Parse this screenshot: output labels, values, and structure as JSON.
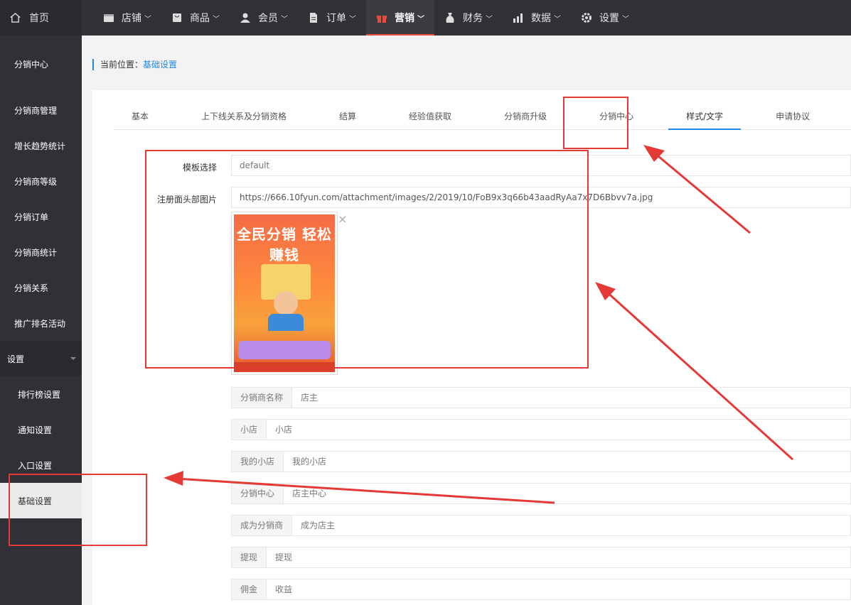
{
  "topbar": {
    "home": "首页",
    "nav": [
      {
        "label": "店铺",
        "icon": "store-icon"
      },
      {
        "label": "商品",
        "icon": "goods-icon"
      },
      {
        "label": "会员",
        "icon": "member-icon"
      },
      {
        "label": "订单",
        "icon": "order-icon"
      },
      {
        "label": "营销",
        "icon": "gift-icon",
        "active": true
      },
      {
        "label": "财务",
        "icon": "money-bag-icon"
      },
      {
        "label": "数据",
        "icon": "bar-chart-icon"
      },
      {
        "label": "设置",
        "icon": "gear-icon"
      }
    ]
  },
  "sidebar": {
    "items": [
      "分销中心",
      "分销商管理",
      "增长趋势统计",
      "分销商等级",
      "分销订单",
      "分销商统计",
      "分销关系",
      "推广排名活动"
    ],
    "group": "设置",
    "sub_items": [
      "排行榜设置",
      "通知设置",
      "入口设置",
      "基础设置"
    ]
  },
  "breadcrumb": {
    "prefix": "当前位置：",
    "link": "基础设置"
  },
  "tabs": [
    "基本",
    "上下线关系及分销资格",
    "结算",
    "经验值获取",
    "分销商升级",
    "分销中心",
    "样式/文字",
    "申请协议"
  ],
  "active_tab": "样式/文字",
  "form": {
    "template_label": "模板选择",
    "template_value": "default",
    "header_image_label": "注册面头部图片",
    "header_image_url": "https://666.10fyun.com/attachment/images/2/2019/10/FoB9x3q66b43aadRyAa7x7D6Bbvv7a.jpg",
    "remove_icon": "×",
    "poster_text": "全民分销 轻松赚钱"
  },
  "text_fields": [
    {
      "label": "分销商名称",
      "value": "店主"
    },
    {
      "label": "小店",
      "value": "小店"
    },
    {
      "label": "我的小店",
      "value": "我的小店"
    },
    {
      "label": "分销中心",
      "value": "店主中心"
    },
    {
      "label": "成为分销商",
      "value": "成为店主"
    },
    {
      "label": "提现",
      "value": "提现"
    },
    {
      "label": "佣金",
      "value": "收益"
    }
  ],
  "colors": {
    "accent": "#1e88e5",
    "highlight": "#e53935",
    "sidebar": "#2f3136"
  }
}
